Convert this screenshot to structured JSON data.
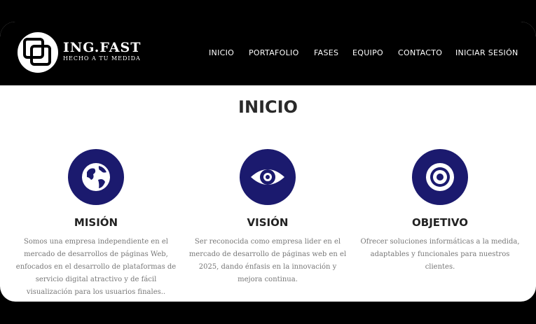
{
  "brand": {
    "name": "ING.FAST",
    "tagline": "HECHO A TU MEDIDA"
  },
  "nav": [
    "INICIO",
    "PORTAFOLIO",
    "FASES",
    "EQUIPO",
    "CONTACTO",
    "INICIAR SESIÓN"
  ],
  "section": {
    "title": "INICIO"
  },
  "cards": [
    {
      "icon": "globe-icon",
      "title": "MISIÓN",
      "text": "Somos una empresa independiente en el mercado de desarrollos de páginas Web, enfocados en el desarrollo de plataformas de servicio digital atractivo y de fácil visualización para los usuarios finales.."
    },
    {
      "icon": "eye-icon",
      "title": "VISIÓN",
      "text": "Ser reconocida como empresa lider en el mercado de desarrollo de páginas web en el 2025, dando énfasis en la innovación y mejora continua."
    },
    {
      "icon": "target-icon",
      "title": "OBJETIVO",
      "text": "Ofrecer soluciones informáticas a la medida, adaptables y funcionales para nuestros clientes."
    }
  ],
  "colors": {
    "accent": "#1b1a6e",
    "navbar": "#000000",
    "text_muted": "#777777"
  }
}
